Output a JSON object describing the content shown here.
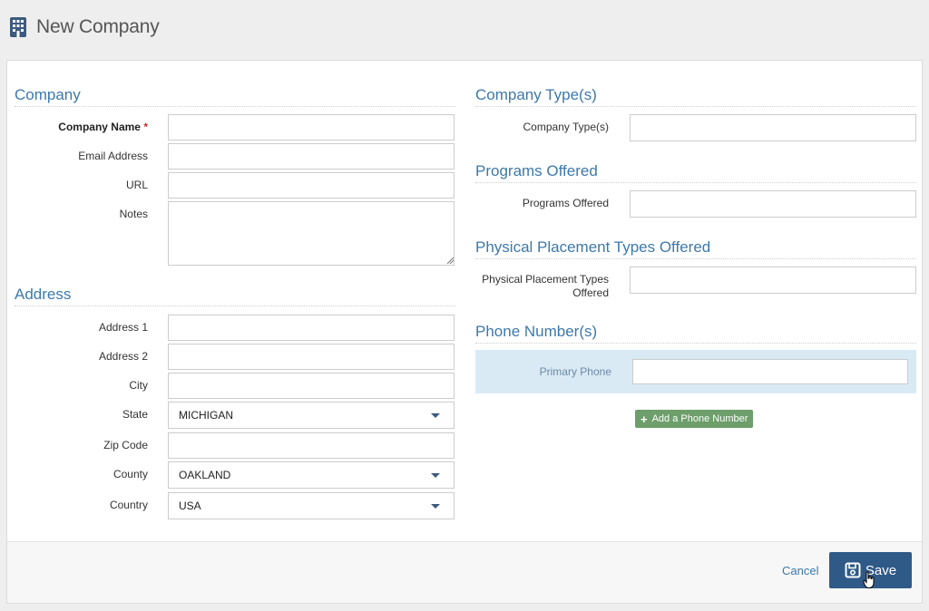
{
  "header": {
    "title": "New Company",
    "icon": "building-icon"
  },
  "company_section": {
    "title": "Company",
    "fields": {
      "company_name": {
        "label": "Company Name",
        "required_mark": "*",
        "value": ""
      },
      "email": {
        "label": "Email Address",
        "value": ""
      },
      "url": {
        "label": "URL",
        "value": ""
      },
      "notes": {
        "label": "Notes",
        "value": ""
      }
    }
  },
  "address_section": {
    "title": "Address",
    "fields": {
      "address1": {
        "label": "Address 1",
        "value": ""
      },
      "address2": {
        "label": "Address 2",
        "value": ""
      },
      "city": {
        "label": "City",
        "value": ""
      },
      "state": {
        "label": "State",
        "value": "MICHIGAN"
      },
      "zip": {
        "label": "Zip Code",
        "value": ""
      },
      "county": {
        "label": "County",
        "value": "OAKLAND"
      },
      "country": {
        "label": "Country",
        "value": "USA"
      }
    }
  },
  "company_types_section": {
    "title": "Company Type(s)",
    "label": "Company Type(s)",
    "value": ""
  },
  "programs_section": {
    "title": "Programs Offered",
    "label": "Programs Offered",
    "value": ""
  },
  "placement_section": {
    "title": "Physical Placement Types Offered",
    "label_line1": "Physical Placement Types",
    "label_line2": "Offered",
    "value": ""
  },
  "phone_section": {
    "title": "Phone Number(s)",
    "primary_label": "Primary Phone",
    "primary_value": "",
    "add_label": "Add a Phone Number"
  },
  "footer": {
    "cancel_label": "Cancel",
    "save_label": "Save"
  },
  "colors": {
    "accent": "#3d79ab",
    "save": "#2f5a87",
    "add": "#6d9e6b",
    "phone_panel": "#d9eaf5",
    "required": "#c9302c"
  }
}
